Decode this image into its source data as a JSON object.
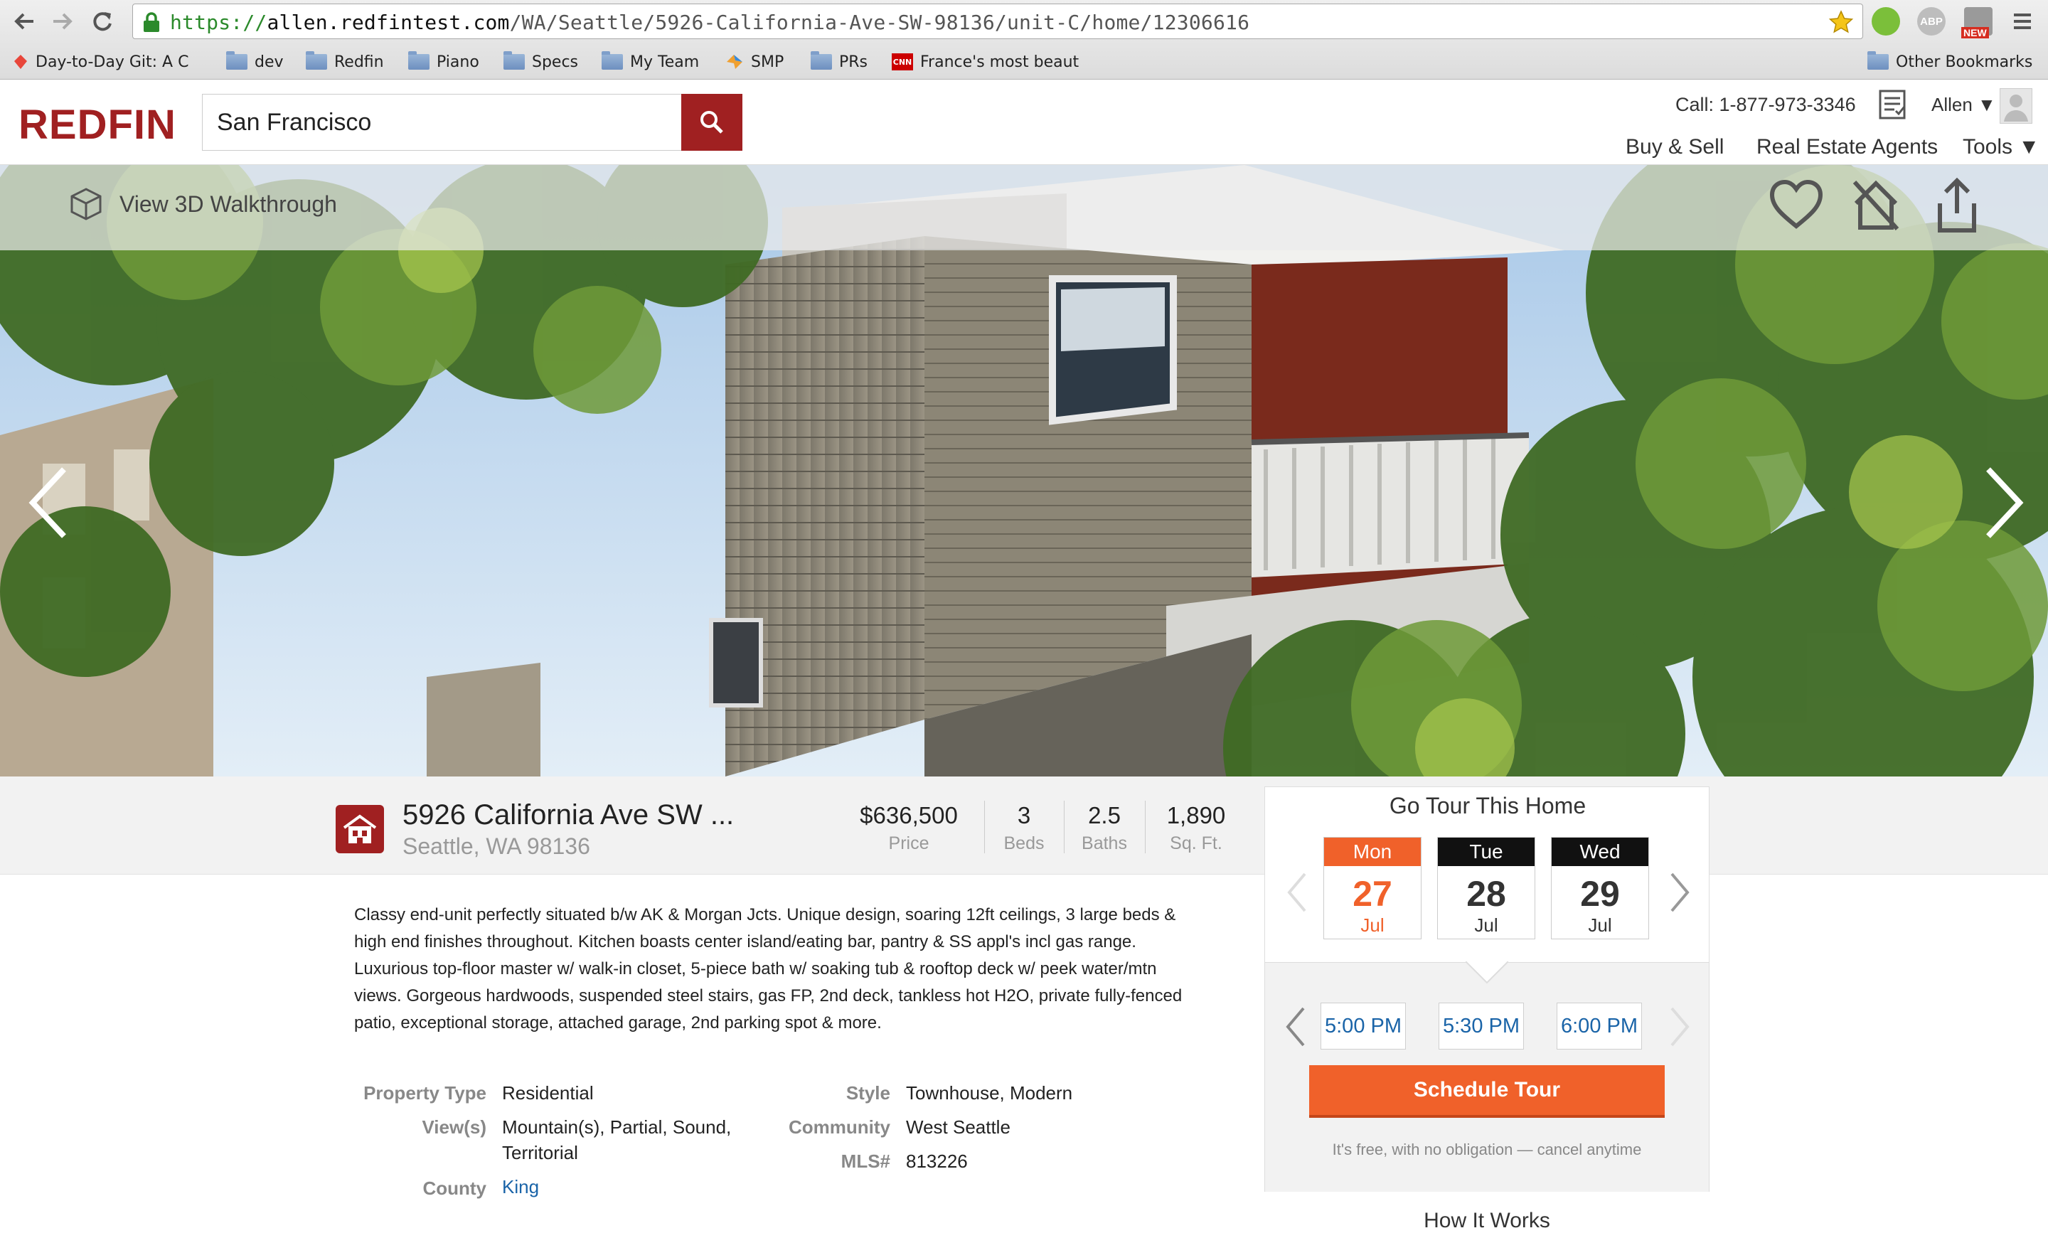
{
  "browser": {
    "url_scheme": "https://",
    "url_host": "allen.redfintest.com",
    "url_path": "/WA/Seattle/5926-California-Ave-SW-98136/unit-C/home/12306616",
    "ext_new_badge": "NEW",
    "ext_abp_label": "ABP",
    "bookmarks": [
      {
        "label": "Day-to-Day Git: A C"
      },
      {
        "label": "dev"
      },
      {
        "label": "Redfin"
      },
      {
        "label": "Piano"
      },
      {
        "label": "Specs"
      },
      {
        "label": "My Team"
      },
      {
        "label": "SMP"
      },
      {
        "label": "PRs"
      },
      {
        "label": "France's most beaut"
      }
    ],
    "other_bookmarks": "Other Bookmarks",
    "cnn_label": "CNN"
  },
  "header": {
    "logo": "REDFIN",
    "search_value": "San Francisco",
    "phone": "Call: 1-877-973-3346",
    "user": "Allen ▼",
    "nav": [
      "Buy & Sell",
      "Real Estate Agents",
      "Tools ▼"
    ]
  },
  "hero": {
    "walkthrough_label": "View 3D Walkthrough"
  },
  "listing": {
    "address_line1": "5926 California Ave SW ...",
    "address_line2": "Seattle, WA 98136",
    "stats": [
      {
        "value": "$636,500",
        "label": "Price"
      },
      {
        "value": "3",
        "label": "Beds"
      },
      {
        "value": "2.5",
        "label": "Baths"
      },
      {
        "value": "1,890",
        "label": "Sq. Ft."
      }
    ],
    "description": "Classy end-unit perfectly situated b/w AK & Morgan Jcts. Unique design, soaring 12ft ceilings, 3 large beds & high end finishes throughout. Kitchen boasts center island/eating bar, pantry & SS appl's incl gas range. Luxurious top-floor master w/ walk-in closet, 5-piece bath w/ soaking tub & rooftop deck w/ peek water/mtn views. Gorgeous hardwoods, suspended steel stairs, gas FP, 2nd deck, tankless hot H2O, private fully-fenced patio, exceptional storage, attached garage, 2nd parking spot & more.",
    "facts_left": [
      {
        "key": "Property Type",
        "value": "Residential"
      },
      {
        "key": "View(s)",
        "value": "Mountain(s), Partial, Sound,",
        "value2": "Territorial"
      },
      {
        "key": "County",
        "value": "King"
      }
    ],
    "facts_right": [
      {
        "key": "Style",
        "value": "Townhouse, Modern"
      },
      {
        "key": "Community",
        "value": "West Seattle"
      },
      {
        "key": "MLS#",
        "value": "813226"
      }
    ]
  },
  "tour": {
    "title": "Go Tour This Home",
    "days": [
      {
        "name": "Mon",
        "date": "27",
        "month": "Jul",
        "selected": true
      },
      {
        "name": "Tue",
        "date": "28",
        "month": "Jul",
        "selected": false
      },
      {
        "name": "Wed",
        "date": "29",
        "month": "Jul",
        "selected": false
      }
    ],
    "times": [
      "5:00 PM",
      "5:30 PM",
      "6:00 PM"
    ],
    "schedule_label": "Schedule Tour",
    "free_note": "It's free, with no obligation — cancel anytime",
    "how_it_works": "How It Works"
  },
  "colors": {
    "brand_red": "#a02021",
    "accent_orange": "#f0612a",
    "link_blue": "#1a64a8"
  }
}
